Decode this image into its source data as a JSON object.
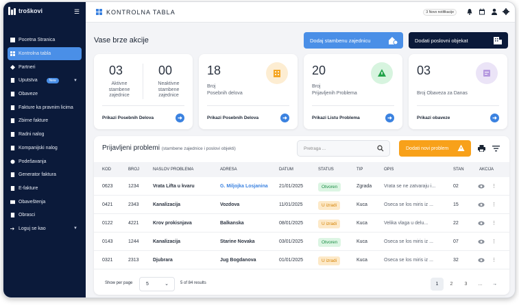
{
  "app": {
    "logo_text": "troškovi"
  },
  "sidebar": {
    "items": [
      {
        "label": "Pocetna Stranica"
      },
      {
        "label": "Kontrolna tabla"
      },
      {
        "label": "Partneri"
      },
      {
        "label": "Uputstva",
        "badge": "New"
      },
      {
        "label": "Obaveze"
      },
      {
        "label": "Fakture ka pravnim licima"
      },
      {
        "label": "Zbirne fakture"
      },
      {
        "label": "Radni nalog"
      },
      {
        "label": "Kompanijski nalog"
      },
      {
        "label": "Podešavanja"
      },
      {
        "label": "Generator faktura"
      },
      {
        "label": "E-fakture"
      },
      {
        "label": "Obaveštenja"
      },
      {
        "label": "Obrasci"
      },
      {
        "label": "Loguj se kao"
      }
    ]
  },
  "header": {
    "title": "KONTROLNA TABLA",
    "notifications": "3 Novo notifikacije"
  },
  "quick": {
    "title": "Vase brze akcije",
    "btn_add_community": "Dodaj stambenu zajednicu",
    "btn_add_business": "Dodati  poslovni objekat"
  },
  "cards": {
    "c1": {
      "active_value": "03",
      "active_label": "Aktivne stambene zajednice",
      "inactive_value": "00",
      "inactive_label": "Neaktivne stambene zajednice",
      "link": "Prikazi Posebnih Delova"
    },
    "c2": {
      "value": "18",
      "label1": "Broj",
      "label2": "Posebnih delova",
      "link": "Prikazi Posebnih Delova"
    },
    "c3": {
      "value": "20",
      "label1": "Broj",
      "label2": "Prijavljenih Problema",
      "link": "Prikazi Listu Problema"
    },
    "c4": {
      "value": "03",
      "label1": "Broj Obaveza za Danas",
      "link": "Prikazi obaveze"
    }
  },
  "problems": {
    "title": "Prijavljeni problemi",
    "subtitle": "(stambene zajednice i poslovi objekti)",
    "search_placeholder": "Pretraga ...",
    "add_button": "Dodati novi problem",
    "columns": [
      "KOD",
      "BROJ",
      "NASLOV PROBLEMA",
      "ADRESA",
      "DATUM",
      "STATUS",
      "TIP",
      "OPIS",
      "STAN",
      "AKCIJA"
    ],
    "rows": [
      {
        "kod": "0623",
        "broj": "1234",
        "naslov": "Vrata Lifta u kvaru",
        "adresa": "G. Miljojka Losjanina",
        "datum": "21/01/2025",
        "status": "Otvoren",
        "tip": "Zgrada",
        "opis": "Vrata se ne zatvaraju i...",
        "stan": "02"
      },
      {
        "kod": "0421",
        "broj": "2343",
        "naslov": "Kanalizacija",
        "adresa": "Vozdova",
        "datum": "11/01/2025",
        "status": "U izradi",
        "tip": "Kuca",
        "opis": "Oseca se los miris iz ...",
        "stan": "15"
      },
      {
        "kod": "0122",
        "broj": "4221",
        "naslov": "Krov prokisnjava",
        "adresa": "Balkanska",
        "datum": "08/01/2025",
        "status": "U izradi",
        "tip": "Kuca",
        "opis": "Velika vlaga u delu...",
        "stan": "22"
      },
      {
        "kod": "0143",
        "broj": "1244",
        "naslov": "Kanalizacija",
        "adresa": "Starine Novaka",
        "datum": "03/01/2025",
        "status": "Otvoren",
        "tip": "Kuca",
        "opis": "Oseca se los miris iz ...",
        "stan": "07"
      },
      {
        "kod": "0321",
        "broj": "2313",
        "naslov": "Djubrara",
        "adresa": "Jug Bogdanova",
        "datum": "01/01/2025",
        "status": "U izradi",
        "tip": "Kuca",
        "opis": "Oseca se los miris iz ...",
        "stan": "32"
      }
    ],
    "pager": {
      "label": "Show per page",
      "per_page": "5",
      "summary": "5 of 84 results",
      "pages": [
        "1",
        "2",
        "3",
        "..."
      ],
      "next": "→"
    }
  },
  "colors": {
    "sidebar": "#0b1a3a",
    "accent": "#4a8fe7",
    "warning": "#f8a11a",
    "open": "#1a8c44",
    "in_progress": "#d48100"
  }
}
